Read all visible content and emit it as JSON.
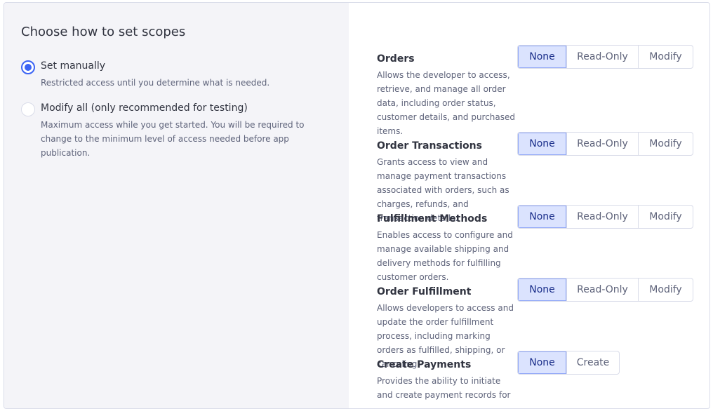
{
  "left": {
    "title": "Choose how to set scopes",
    "options": [
      {
        "label": "Set manually",
        "description": "Restricted access until you determine what is needed.",
        "checked": true
      },
      {
        "label": "Modify all (only recommended for testing)",
        "description": "Maximum access while you get started. You will be required to change to the minimum level of access needed before app publication.",
        "checked": false
      }
    ]
  },
  "scopes": [
    {
      "title": "Orders",
      "description": "Allows the developer to access, retrieve, and manage all order data, including order status, customer details, and purchased items.",
      "options": [
        "None",
        "Read-Only",
        "Modify"
      ],
      "selected": "None"
    },
    {
      "title": "Order Transactions",
      "description": "Grants access to view and manage payment transactions associated with orders, such as charges, refunds, and transaction details.",
      "options": [
        "None",
        "Read-Only",
        "Modify"
      ],
      "selected": "None"
    },
    {
      "title": "Fulfillment Methods",
      "description": "Enables access to configure and manage available shipping and delivery methods for fulfilling customer orders.",
      "options": [
        "None",
        "Read-Only",
        "Modify"
      ],
      "selected": "None"
    },
    {
      "title": "Order Fulfillment",
      "description": "Allows developers to access and update the order fulfillment process, including marking orders as fulfilled, shipping, or canceling.",
      "options": [
        "None",
        "Read-Only",
        "Modify"
      ],
      "selected": "None"
    },
    {
      "title": "Create Payments",
      "description": "Provides the ability to initiate and create payment records for",
      "options": [
        "None",
        "Create"
      ],
      "selected": "None"
    }
  ],
  "colors": {
    "accent": "#3c64f4",
    "selected_bg": "#dbe3fe",
    "left_panel_bg": "#f4f4f8"
  }
}
